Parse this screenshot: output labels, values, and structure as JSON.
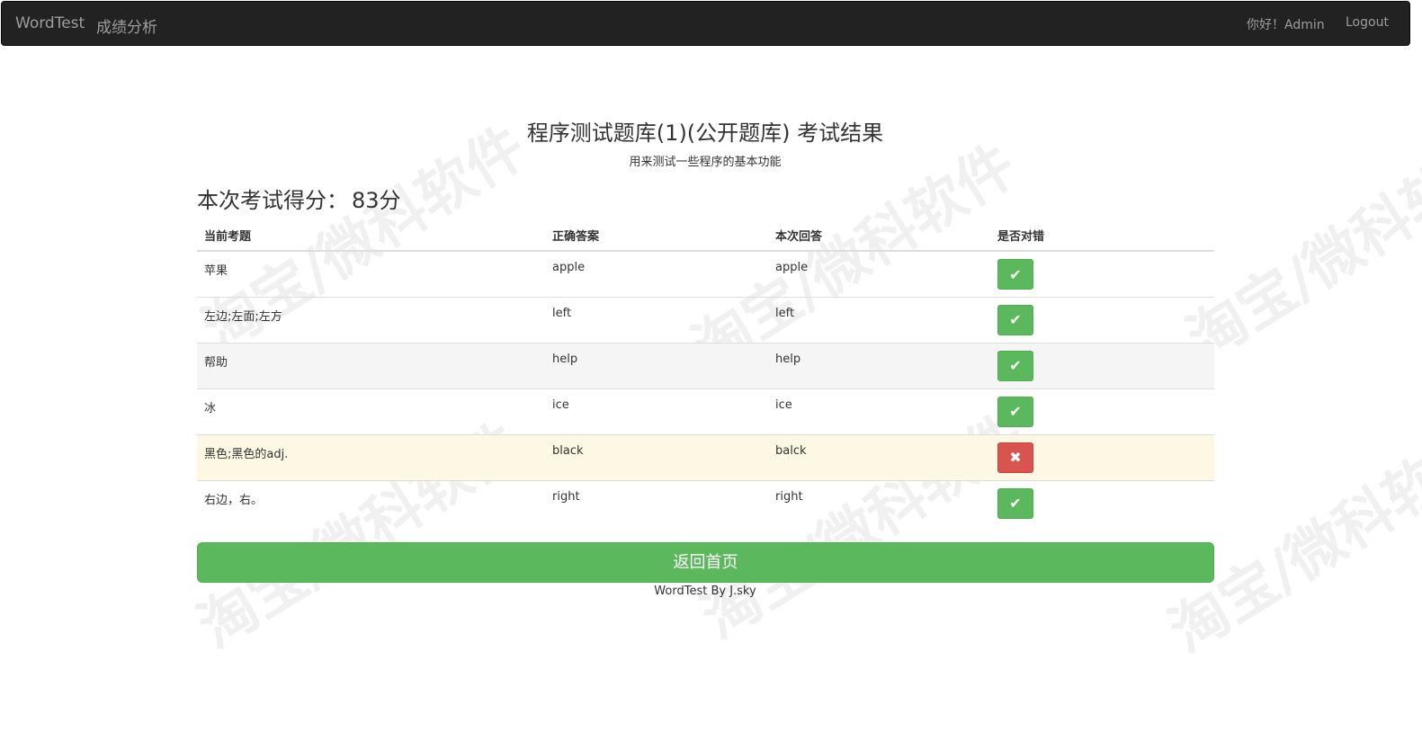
{
  "navbar": {
    "brand": "WordTest",
    "analysis_link": "成绩分析",
    "greeting": "你好！Admin",
    "logout": "Logout"
  },
  "watermark": "淘宝/微科软件",
  "page": {
    "title": "程序测试题库(1)(公开题库) 考试结果",
    "subtitle": "用来测试一些程序的基本功能",
    "score_label": "本次考试得分：",
    "score_value": "83分"
  },
  "table": {
    "headers": [
      "当前考题",
      "正确答案",
      "本次回答",
      "是否对错"
    ],
    "rows": [
      {
        "question": "苹果",
        "correct": "apple",
        "answer": "apple",
        "result": "correct"
      },
      {
        "question": "左边;左面;左方",
        "correct": "left",
        "answer": "left",
        "result": "correct"
      },
      {
        "question": "帮助",
        "correct": "help",
        "answer": "help",
        "result": "correct"
      },
      {
        "question": "冰",
        "correct": "ice",
        "answer": "ice",
        "result": "correct"
      },
      {
        "question": "黑色;黑色的adj.",
        "correct": "black",
        "answer": "balck",
        "result": "wrong"
      },
      {
        "question": "右边，右。",
        "correct": "right",
        "answer": "right",
        "result": "correct"
      }
    ]
  },
  "icons": {
    "correct": "check-icon",
    "wrong": "times-icon"
  },
  "colors": {
    "success": "#5cb85c",
    "danger": "#d9534f",
    "navbar": "#222222",
    "warning_row": "#fcf8e3"
  },
  "home_button": "返回首页",
  "footer": "WordTest By J.sky"
}
